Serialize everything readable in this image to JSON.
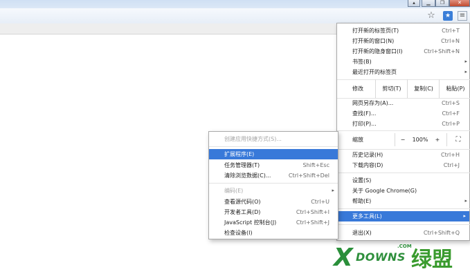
{
  "window_controls": {
    "minimize": "▁",
    "restore": "❐",
    "close": "✕",
    "user": "▴"
  },
  "toolbar": {
    "star_icon": "☆",
    "ext_icon": "★",
    "menu_icon": "≡"
  },
  "main_menu": {
    "items": [
      {
        "label": "打开新的标签页(T)",
        "shortcut": "Ctrl+T"
      },
      {
        "label": "打开新的窗口(N)",
        "shortcut": "Ctrl+N"
      },
      {
        "label": "打开新的隐身窗口(I)",
        "shortcut": "Ctrl+Shift+N"
      },
      {
        "label": "书签(B)",
        "arrow": "▸"
      },
      {
        "label": "最近打开的标签页",
        "arrow": "▸"
      }
    ],
    "edit": {
      "label": "修改",
      "cut": "剪切(T)",
      "copy": "复制(C)",
      "paste": "粘贴(P)"
    },
    "items2": [
      {
        "label": "网页另存为(A)...",
        "shortcut": "Ctrl+S"
      },
      {
        "label": "查找(F)...",
        "shortcut": "Ctrl+F"
      },
      {
        "label": "打印(P)...",
        "shortcut": "Ctrl+P"
      }
    ],
    "zoom": {
      "label": "缩放",
      "minus": "−",
      "value": "100%",
      "plus": "+",
      "fullscreen": "⛶"
    },
    "items3": [
      {
        "label": "历史记录(H)",
        "shortcut": "Ctrl+H"
      },
      {
        "label": "下载内容(D)",
        "shortcut": "Ctrl+J"
      }
    ],
    "items4": [
      {
        "label": "设置(S)"
      },
      {
        "label": "关于 Google Chrome(G)"
      },
      {
        "label": "帮助(E)",
        "arrow": "▸"
      }
    ],
    "more_tools": {
      "label": "更多工具(L)",
      "arrow": "▸"
    },
    "exit": {
      "label": "退出(X)",
      "shortcut": "Ctrl+Shift+Q"
    }
  },
  "sub_menu": {
    "create_shortcut": "创建应用快捷方式(S)...",
    "items": [
      {
        "label": "扩展程序(E)",
        "shortcut": ""
      },
      {
        "label": "任务管理器(T)",
        "shortcut": "Shift+Esc"
      },
      {
        "label": "清除浏览数据(C)...",
        "shortcut": "Ctrl+Shift+Del"
      }
    ],
    "encoding": {
      "label": "编码(E)",
      "arrow": "▸"
    },
    "items2": [
      {
        "label": "查看源代码(O)",
        "shortcut": "Ctrl+U"
      },
      {
        "label": "开发者工具(D)",
        "shortcut": "Ctrl+Shift+I"
      },
      {
        "label": "JavaScript 控制台(J)",
        "shortcut": "Ctrl+Shift+J"
      },
      {
        "label": "检查设备(I)",
        "shortcut": ""
      }
    ]
  },
  "watermark": {
    "x": "X",
    "downs": "DOWNS",
    "com": ".COM",
    "cn": "绿盟"
  }
}
